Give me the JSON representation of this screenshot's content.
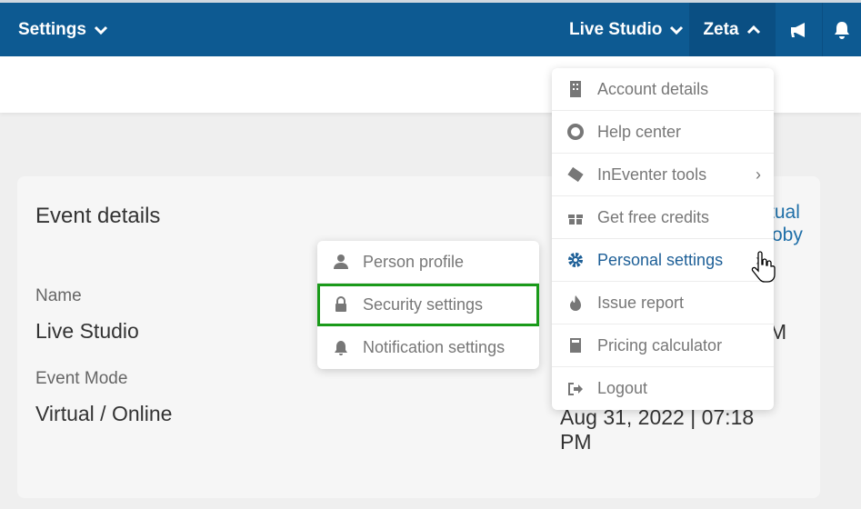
{
  "topbar": {
    "settings": "Settings",
    "event": "Live Studio",
    "user": "Zeta"
  },
  "card": {
    "title": "Event details",
    "name_label": "Name",
    "name_value": "Live Studio",
    "mode_label": "Event Mode",
    "mode_value": "Virtual / Online",
    "link_frag1": "tual",
    "link_frag2": "oby",
    "time_frag": "M",
    "date_frag": "Aug 31, 2022 | 07:18",
    "date_frag2": "PM"
  },
  "user_menu": [
    {
      "label": "Account details",
      "icon": "building-icon"
    },
    {
      "label": "Help center",
      "icon": "lifebuoy-icon"
    },
    {
      "label": "InEventer tools",
      "icon": "inevent-logo-icon",
      "submenu": true
    },
    {
      "label": "Get free credits",
      "icon": "gift-icon"
    },
    {
      "label": "Personal settings",
      "icon": "gear-icon",
      "submenu": true,
      "active": true
    },
    {
      "label": "Issue report",
      "icon": "fire-icon"
    },
    {
      "label": "Pricing calculator",
      "icon": "calculator-icon"
    },
    {
      "label": "Logout",
      "icon": "logout-icon"
    }
  ],
  "personal_menu": [
    {
      "label": "Person profile",
      "icon": "user-icon"
    },
    {
      "label": "Security settings",
      "icon": "lock-icon",
      "highlighted": true
    },
    {
      "label": "Notification settings",
      "icon": "bell-icon"
    }
  ],
  "colors": {
    "topbar": "#0d5a92",
    "active": "#1d5f97",
    "highlight": "#1a9a1a"
  }
}
